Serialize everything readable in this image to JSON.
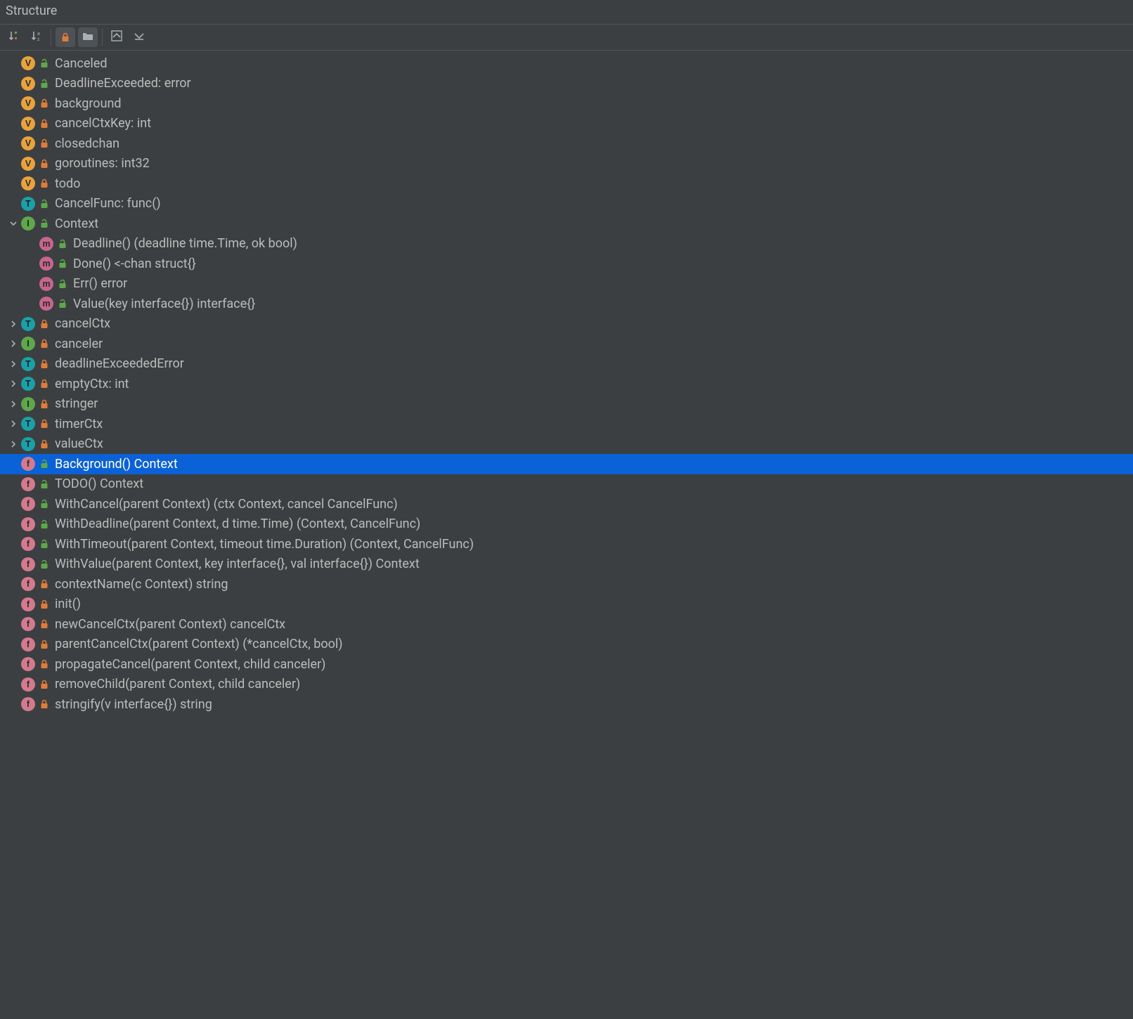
{
  "panel": {
    "title": "Structure"
  },
  "toolbar": {
    "buttons": [
      {
        "name": "sort-by-visibility",
        "active": false
      },
      {
        "name": "sort-alphabetically",
        "active": false
      },
      {
        "sep": true
      },
      {
        "name": "show-non-public-toggle",
        "active": true
      },
      {
        "name": "group-toggle",
        "active": true
      },
      {
        "sep": true
      },
      {
        "name": "expand-all",
        "active": false
      },
      {
        "name": "collapse-all",
        "active": false
      }
    ]
  },
  "colors": {
    "lock_private": "#e07c3a",
    "unlock_public": "#5ea84b",
    "arrow": "#a9b0b4"
  },
  "tree": [
    {
      "arrow": "",
      "depth": 0,
      "kind": "V",
      "vis": "public",
      "label": "Canceled"
    },
    {
      "arrow": "",
      "depth": 0,
      "kind": "V",
      "vis": "public",
      "label": "DeadlineExceeded: error"
    },
    {
      "arrow": "",
      "depth": 0,
      "kind": "V",
      "vis": "private",
      "label": "background"
    },
    {
      "arrow": "",
      "depth": 0,
      "kind": "V",
      "vis": "private",
      "label": "cancelCtxKey: int"
    },
    {
      "arrow": "",
      "depth": 0,
      "kind": "V",
      "vis": "private",
      "label": "closedchan"
    },
    {
      "arrow": "",
      "depth": 0,
      "kind": "V",
      "vis": "private",
      "label": "goroutines: int32"
    },
    {
      "arrow": "",
      "depth": 0,
      "kind": "V",
      "vis": "private",
      "label": "todo"
    },
    {
      "arrow": "",
      "depth": 0,
      "kind": "T",
      "vis": "public",
      "label": "CancelFunc: func()"
    },
    {
      "arrow": "down",
      "depth": 0,
      "kind": "I",
      "vis": "public",
      "label": "Context"
    },
    {
      "arrow": "",
      "depth": 1,
      "kind": "m",
      "vis": "public",
      "label": "Deadline() (deadline time.Time, ok bool)"
    },
    {
      "arrow": "",
      "depth": 1,
      "kind": "m",
      "vis": "public",
      "label": "Done() <-chan struct{}"
    },
    {
      "arrow": "",
      "depth": 1,
      "kind": "m",
      "vis": "public",
      "label": "Err() error"
    },
    {
      "arrow": "",
      "depth": 1,
      "kind": "m",
      "vis": "public",
      "label": "Value(key interface{}) interface{}"
    },
    {
      "arrow": "right",
      "depth": 0,
      "kind": "T",
      "vis": "private",
      "label": "cancelCtx"
    },
    {
      "arrow": "right",
      "depth": 0,
      "kind": "I",
      "vis": "private",
      "label": "canceler"
    },
    {
      "arrow": "right",
      "depth": 0,
      "kind": "T",
      "vis": "private",
      "label": "deadlineExceededError"
    },
    {
      "arrow": "right",
      "depth": 0,
      "kind": "T",
      "vis": "private",
      "label": "emptyCtx: int"
    },
    {
      "arrow": "right",
      "depth": 0,
      "kind": "I",
      "vis": "private",
      "label": "stringer"
    },
    {
      "arrow": "right",
      "depth": 0,
      "kind": "T",
      "vis": "private",
      "label": "timerCtx"
    },
    {
      "arrow": "right",
      "depth": 0,
      "kind": "T",
      "vis": "private",
      "label": "valueCtx"
    },
    {
      "arrow": "",
      "depth": 0,
      "kind": "f",
      "vis": "public",
      "label": "Background() Context",
      "selected": true
    },
    {
      "arrow": "",
      "depth": 0,
      "kind": "f",
      "vis": "public",
      "label": "TODO() Context"
    },
    {
      "arrow": "",
      "depth": 0,
      "kind": "f",
      "vis": "public",
      "label": "WithCancel(parent Context) (ctx Context, cancel CancelFunc)"
    },
    {
      "arrow": "",
      "depth": 0,
      "kind": "f",
      "vis": "public",
      "label": "WithDeadline(parent Context, d time.Time) (Context, CancelFunc)"
    },
    {
      "arrow": "",
      "depth": 0,
      "kind": "f",
      "vis": "public",
      "label": "WithTimeout(parent Context, timeout time.Duration) (Context, CancelFunc)"
    },
    {
      "arrow": "",
      "depth": 0,
      "kind": "f",
      "vis": "public",
      "label": "WithValue(parent Context, key interface{}, val interface{}) Context"
    },
    {
      "arrow": "",
      "depth": 0,
      "kind": "f",
      "vis": "private",
      "label": "contextName(c Context) string"
    },
    {
      "arrow": "",
      "depth": 0,
      "kind": "f",
      "vis": "private",
      "label": "init()"
    },
    {
      "arrow": "",
      "depth": 0,
      "kind": "f",
      "vis": "private",
      "label": "newCancelCtx(parent Context) cancelCtx"
    },
    {
      "arrow": "",
      "depth": 0,
      "kind": "f",
      "vis": "private",
      "label": "parentCancelCtx(parent Context) (*cancelCtx, bool)"
    },
    {
      "arrow": "",
      "depth": 0,
      "kind": "f",
      "vis": "private",
      "label": "propagateCancel(parent Context, child canceler)"
    },
    {
      "arrow": "",
      "depth": 0,
      "kind": "f",
      "vis": "private",
      "label": "removeChild(parent Context, child canceler)"
    },
    {
      "arrow": "",
      "depth": 0,
      "kind": "f",
      "vis": "private",
      "label": "stringify(v interface{}) string"
    }
  ]
}
